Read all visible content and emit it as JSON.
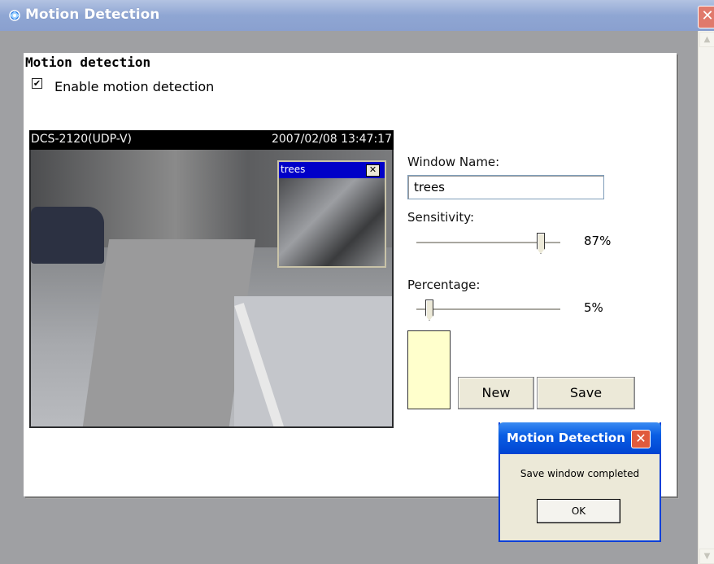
{
  "window": {
    "title": "Motion Detection",
    "close_label": "✕"
  },
  "section": {
    "title": "Motion detection",
    "enable_label": "Enable motion detection",
    "enable_checked": true
  },
  "video": {
    "camera_name": "DCS-2120(UDP-V)",
    "timestamp": "2007/02/08 13:47:17",
    "motion_window": {
      "name": "trees",
      "close_label": "✕"
    }
  },
  "form": {
    "window_name_label": "Window Name:",
    "window_name_value": "trees",
    "sensitivity_label": "Sensitivity:",
    "sensitivity_value": "87%",
    "sensitivity_level": 87,
    "percentage_label": "Percentage:",
    "percentage_value": "5%",
    "percentage_level": 5,
    "swatch_color": "#ffffcc",
    "new_label": "New",
    "save_label": "Save"
  },
  "dialog": {
    "title": "Motion Detection",
    "close_label": "✕",
    "message": "Save window completed",
    "ok_label": "OK"
  },
  "icons": {
    "title_icon": "motion-eye-icon",
    "check": "✔"
  }
}
